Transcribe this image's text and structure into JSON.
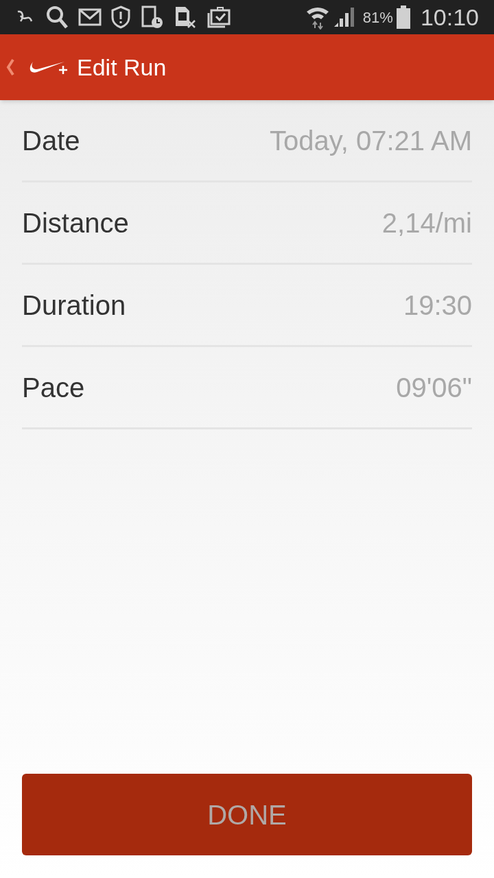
{
  "status_bar": {
    "battery": "81%",
    "time": "10:10"
  },
  "app_bar": {
    "title": "Edit Run"
  },
  "fields": [
    {
      "label": "Date",
      "value": "Today, 07:21 AM"
    },
    {
      "label": "Distance",
      "value": "2,14/mi"
    },
    {
      "label": "Duration",
      "value": "19:30"
    },
    {
      "label": "Pace",
      "value": "09'06\""
    }
  ],
  "done_button": {
    "label": "DONE",
    "disabled": true
  }
}
